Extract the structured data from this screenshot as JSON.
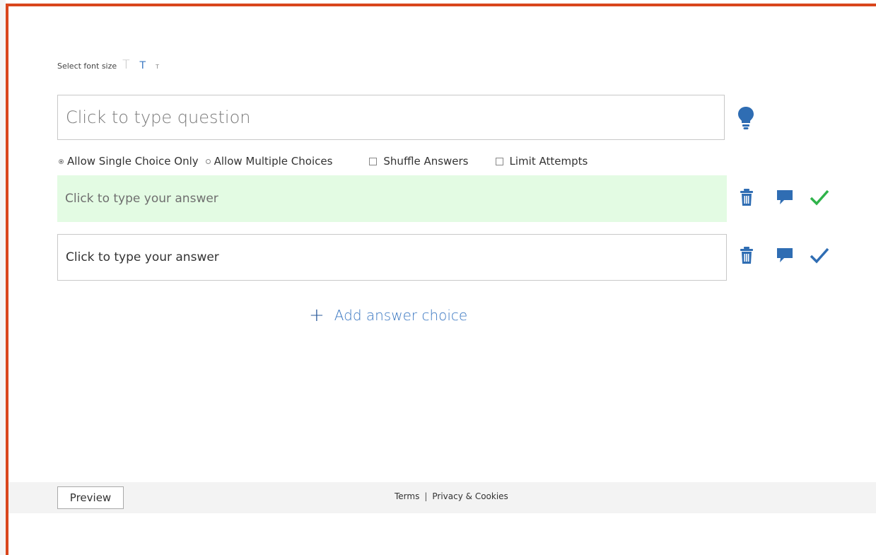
{
  "font_size": {
    "label": "Select font size",
    "options": [
      "T",
      "T",
      "T"
    ]
  },
  "question": {
    "placeholder": "Click to type question"
  },
  "options": {
    "single_choice": "Allow Single Choice Only",
    "multiple_choices": "Allow Multiple Choices",
    "shuffle": "Shuffle Answers",
    "limit_attempts": "Limit Attempts",
    "single_choice_selected": true,
    "shuffle_checked": false,
    "limit_checked": false
  },
  "answers": [
    {
      "text": "Click to type your answer",
      "correct": true
    },
    {
      "text": "Click to type your answer",
      "correct": false
    }
  ],
  "add_answer_label": "Add answer choice",
  "footer": {
    "preview_label": "Preview",
    "terms": "Terms",
    "separator": "|",
    "privacy": "Privacy & Cookies"
  },
  "colors": {
    "accent_border": "#d9461c",
    "brand_blue": "#3b78c2",
    "correct_green": "#2fb34a",
    "correct_row_bg": "#e3fbe3"
  },
  "icons": [
    "lightbulb-icon",
    "trash-icon",
    "comment-icon",
    "checkmark-icon",
    "plus-icon"
  ]
}
